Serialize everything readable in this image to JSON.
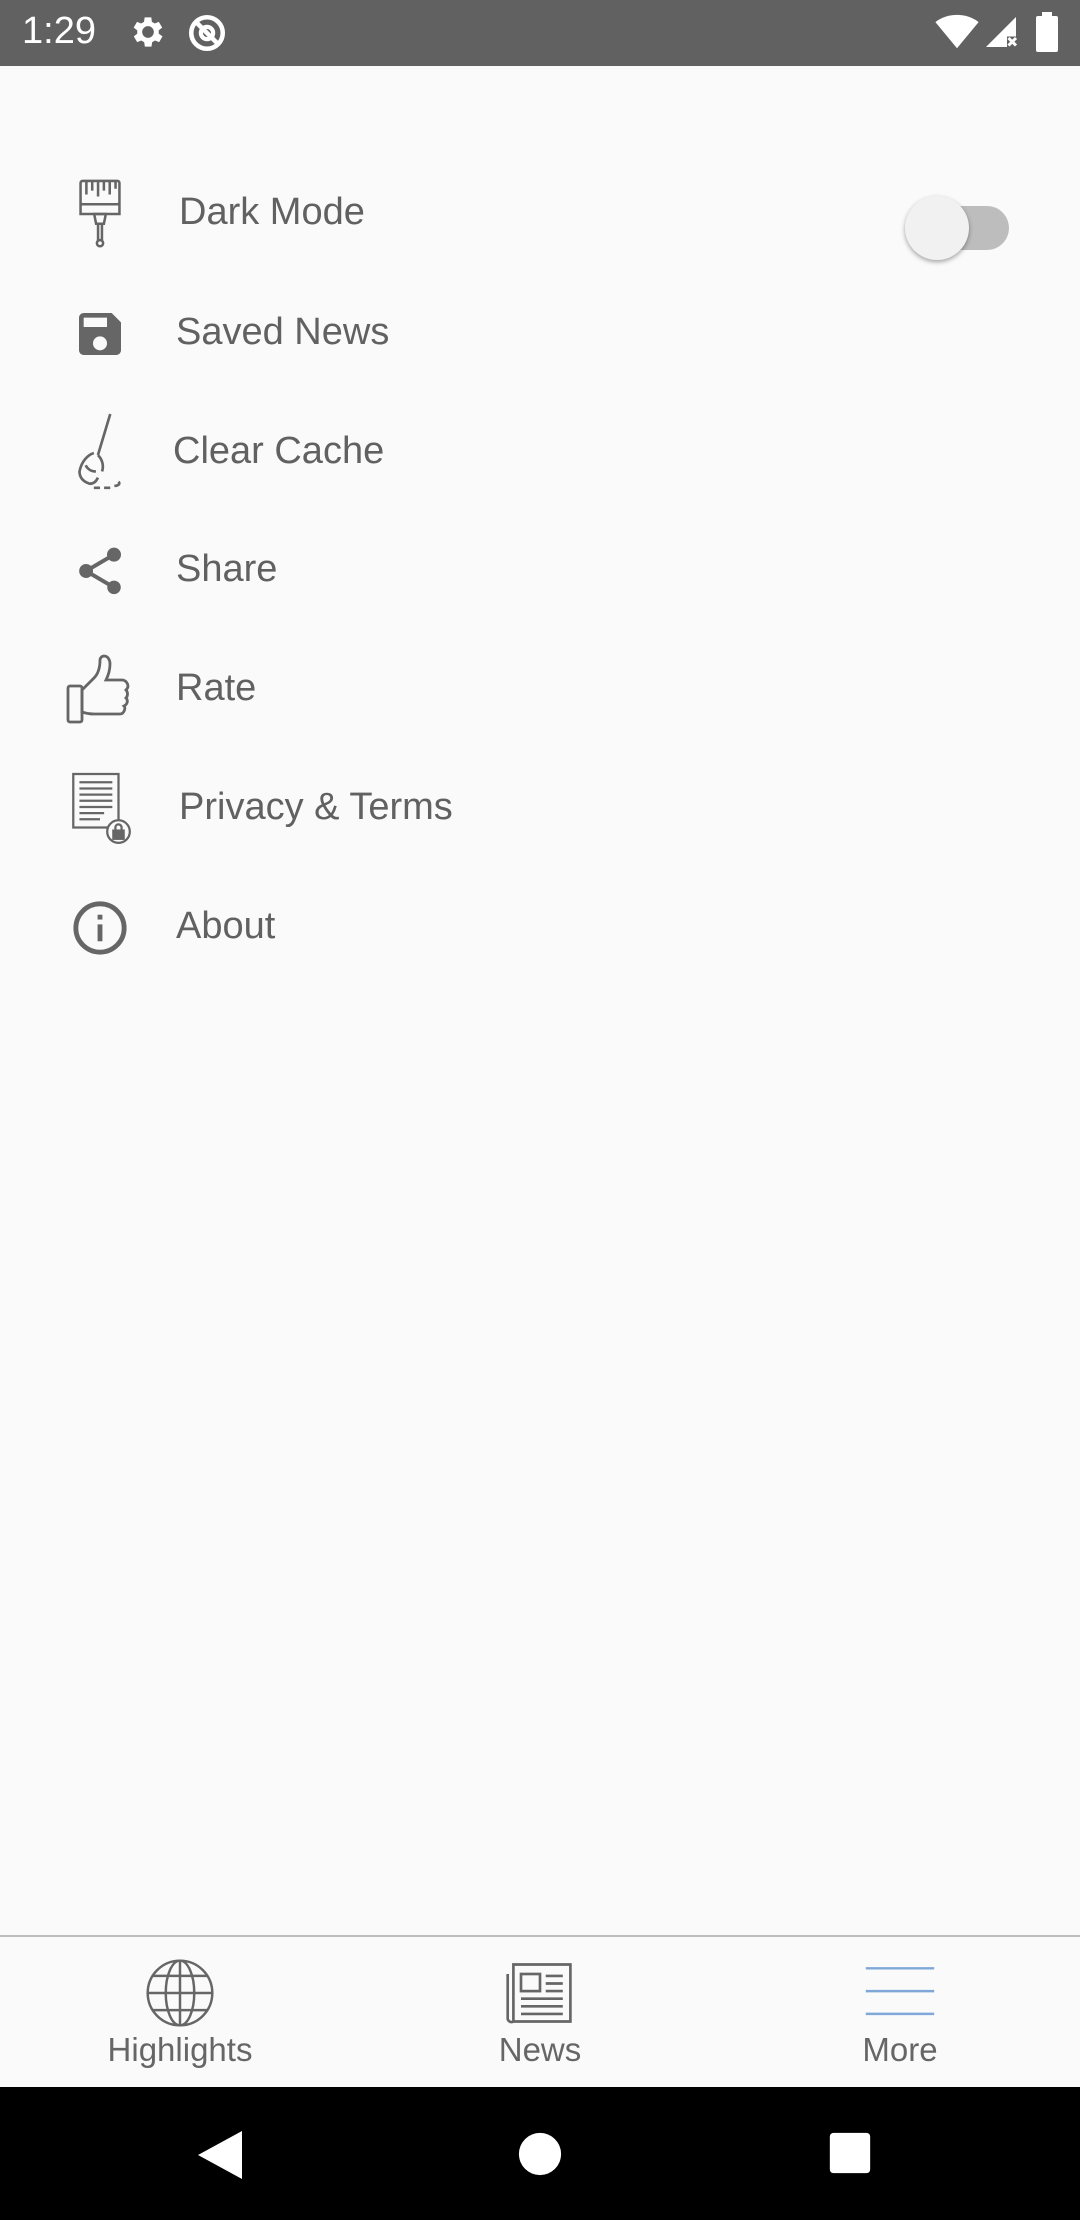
{
  "status_bar": {
    "time": "1:29",
    "icons": [
      "gear-icon",
      "no-data-icon",
      "wifi-icon",
      "signal-icon",
      "battery-icon"
    ]
  },
  "menu": {
    "items": [
      {
        "label": "Dark Mode",
        "icon": "paint-brush-icon"
      },
      {
        "label": "Saved News",
        "icon": "floppy-disk-icon"
      },
      {
        "label": "Clear Cache",
        "icon": "broom-icon"
      },
      {
        "label": "Share",
        "icon": "share-icon"
      },
      {
        "label": "Rate",
        "icon": "thumbs-up-icon"
      },
      {
        "label": "Privacy & Terms",
        "icon": "document-lock-icon"
      },
      {
        "label": "About",
        "icon": "info-icon"
      }
    ],
    "dark_mode_enabled": false
  },
  "bottom_nav": {
    "tabs": [
      {
        "label": "Highlights",
        "icon": "globe-icon"
      },
      {
        "label": "News",
        "icon": "newspaper-icon"
      },
      {
        "label": "More",
        "icon": "menu-lines-icon",
        "active": true
      }
    ],
    "active_color": "#7fa8d9"
  },
  "system_nav": {
    "buttons": [
      "back-icon",
      "home-icon",
      "recents-icon"
    ]
  }
}
